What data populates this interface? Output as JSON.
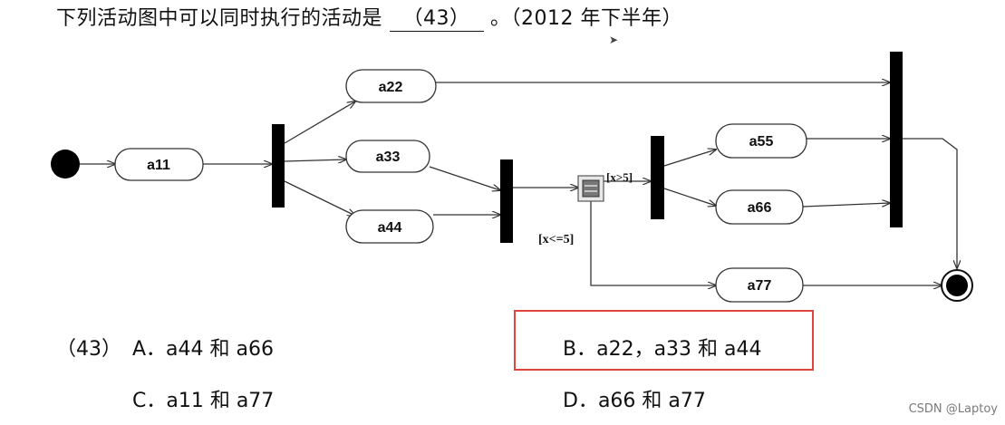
{
  "question": {
    "prefix": "下列活动图中可以同时执行的活动是",
    "blank": "（43）",
    "suffix": "。（2012 年下半年）"
  },
  "diagram": {
    "activities": [
      "a11",
      "a22",
      "a33",
      "a44",
      "a55",
      "a66",
      "a77"
    ],
    "guards": {
      "upper": "[x>5]",
      "lower": "[x<=5]"
    }
  },
  "options": {
    "number": "（43）",
    "A": "A．a44 和 a66",
    "B": "B．a22，a33 和 a44",
    "C": "C．a11 和 a77",
    "D": "D．a66 和 a77"
  },
  "highlight_color": "#e0443f",
  "watermark": "CSDN @Laptoy"
}
